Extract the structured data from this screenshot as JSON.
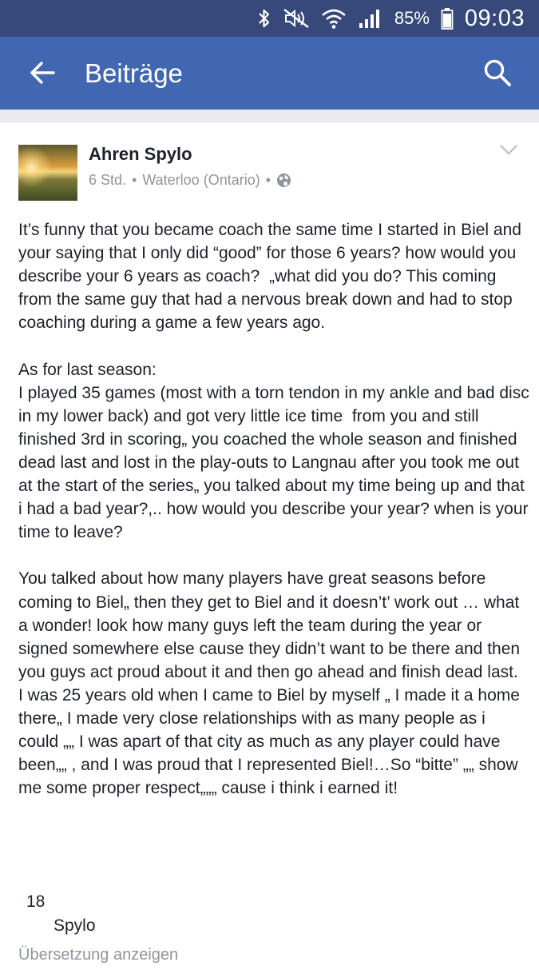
{
  "status_bar": {
    "icons": [
      "bluetooth-icon",
      "mute-icon",
      "wifi-icon",
      "signal-icon",
      "battery-icon"
    ],
    "battery": "85%",
    "time": "09:03"
  },
  "app_bar": {
    "title": "Beiträge",
    "back_icon": "arrow-left-icon",
    "search_icon": "search-icon",
    "color": "#4267b2"
  },
  "post": {
    "author": "Ahren Spylo",
    "time": "6 Std.",
    "location": "Waterloo (Ontario)",
    "separator": "•",
    "privacy_icon": "globe-icon",
    "menu_icon": "chevron-down-icon",
    "text": "It’s funny that you became coach the same time I started in Biel and your saying that I only did “good” for those 6 years? how would you describe your 6 years as coach?  „what did you do? This coming from the same guy that had a nervous break down and had to stop coaching during a game a few years ago.\n\nAs for last season:\nI played 35 games (most with a torn tendon in my ankle and bad disc in my lower back) and got very little ice time  from you and still finished 3rd in scoring„ you coached the whole season and finished dead last and lost in the play-outs to Langnau after you took me out at the start of the series„ you talked about my time being up and that i had a bad year?,.. how would you describe your year? when is your time to leave?\n\nYou talked about how many players have great seasons before coming to Biel„ then they get to Biel and it doesn’t’ work out … what a wonder! look how many guys left the team during the year or signed somewhere else cause they didn’t want to be there and then you guys act proud about it and then go ahead and finish dead last.\nI was 25 years old when I came to Biel by myself „ I made it a home there„ I made very close relationships with as many people as i could „„ I was apart of that city as much as any player could have been„„ , and I was proud that I represented Biel!…So “bitte” „„ show me some proper respect„„„ cause i think i earned it!",
    "like_count": "18",
    "liker": "Spylo",
    "translate_label": "Übersetzung anzeigen"
  }
}
